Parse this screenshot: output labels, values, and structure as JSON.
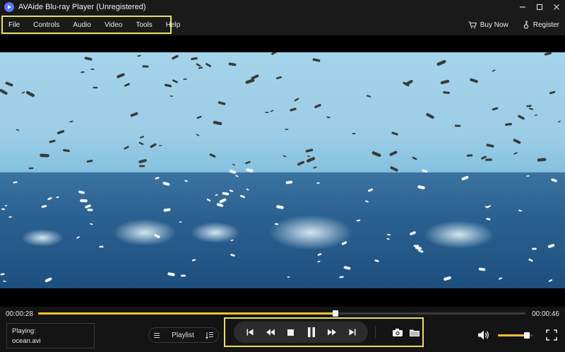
{
  "window": {
    "title": "AVAide Blu-ray Player (Unregistered)"
  },
  "menu": {
    "items": [
      "File",
      "Controls",
      "Audio",
      "Video",
      "Tools",
      "Help"
    ],
    "buy_now": "Buy Now",
    "register": "Register"
  },
  "player": {
    "current_time": "00:00:28",
    "total_time": "00:00:46",
    "progress": 0.61,
    "playing_label": "Playing:",
    "file_name": "ocean.avi",
    "playlist_label": "Playlist",
    "volume": 0.82
  },
  "colors": {
    "accent": "#f2c230",
    "highlight_box": "#e9df66",
    "background": "#141414"
  },
  "icons": {
    "previous": "skip-previous-icon",
    "rewind": "rewind-icon",
    "stop": "stop-icon",
    "pause": "pause-icon",
    "forward": "fast-forward-icon",
    "next": "skip-next-icon",
    "snapshot": "camera-icon",
    "open": "folder-icon",
    "volume": "speaker-icon",
    "fullscreen": "fullscreen-icon"
  }
}
